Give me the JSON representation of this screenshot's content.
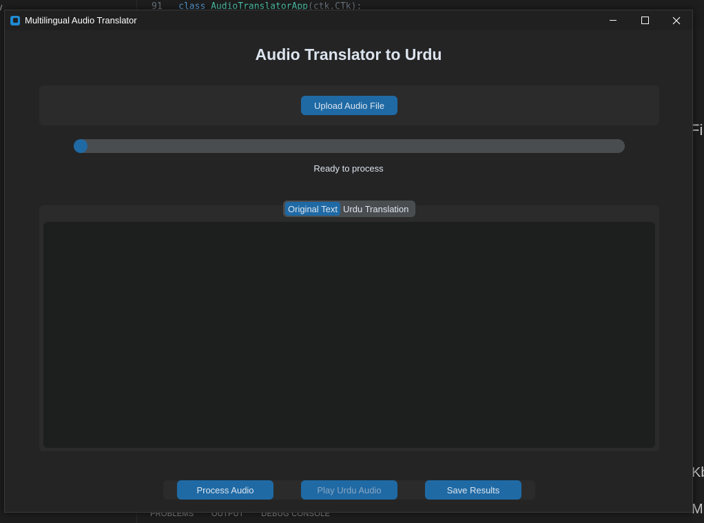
{
  "background": {
    "code_line_number": "91",
    "code_keyword": "class",
    "code_class": "AudioTranslatorApp",
    "code_args": "(ctk.CTk):",
    "panel_tabs": [
      "PROBLEMS",
      "OUTPUT",
      "DEBUG CONSOLE"
    ],
    "right_glyphs": [
      "Fi",
      "Kb",
      "Mb"
    ]
  },
  "window": {
    "title": "Multilingual Audio Translator",
    "icon": "app-window-icon",
    "controls": [
      "minimize-icon",
      "maximize-icon",
      "close-icon"
    ]
  },
  "main": {
    "heading": "Audio Translator to Urdu",
    "upload_label": "Upload Audio File",
    "progress": 0.0,
    "status": "Ready to process",
    "tabs": [
      {
        "label": "Original Text",
        "active": true
      },
      {
        "label": "Urdu Translation",
        "active": false
      }
    ],
    "textbox_value": ""
  },
  "actions": {
    "process_label": "Process Audio",
    "play_label": "Play Urdu Audio",
    "save_label": "Save Results"
  },
  "colors": {
    "accent": "#1f6aa5",
    "window_bg": "#242424",
    "frame_bg": "#2b2b2b",
    "text": "#dce4ee"
  }
}
